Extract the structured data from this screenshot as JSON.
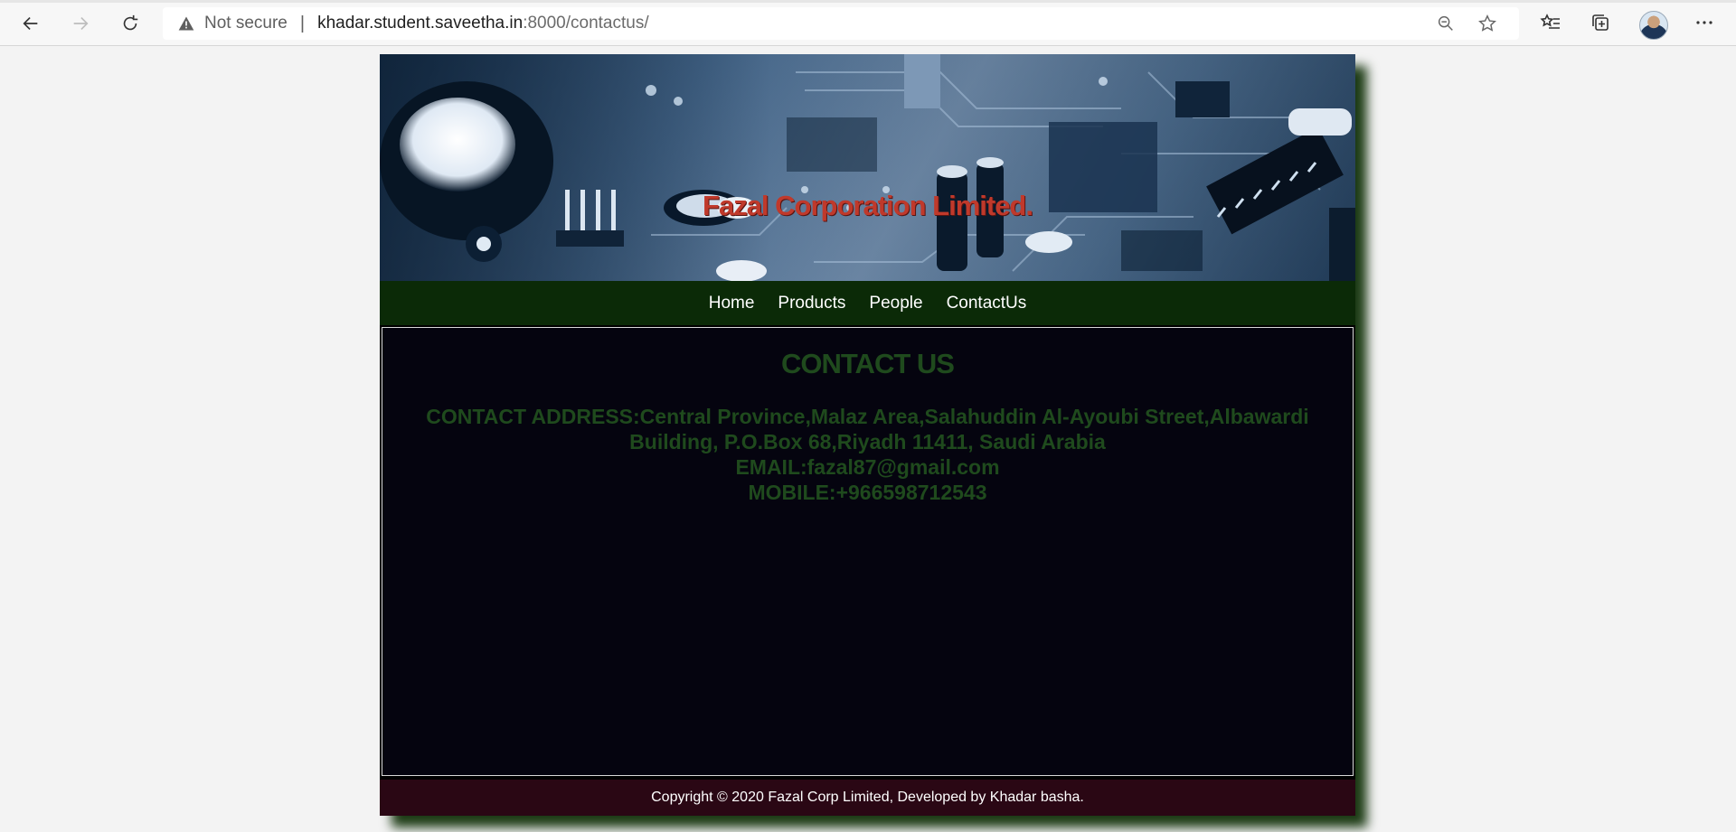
{
  "browser": {
    "security_label": "Not secure",
    "url_host": "khadar.student.saveetha.in",
    "url_rest": ":8000/contactus/"
  },
  "site": {
    "banner_title": "Fazal Corporation Limited.",
    "nav": [
      "Home",
      "Products",
      "People",
      "ContactUs"
    ],
    "section_title": "CONTACT US",
    "address_line": "CONTACT ADDRESS:Central Province,Malaz Area,Salahuddin Al-Ayoubi Street,Albawardi Building, P.O.Box 68,Riyadh 11411, Saudi Arabia",
    "email_line": "EMAIL:fazal87@gmail.com",
    "mobile_line": "MOBILE:+966598712543",
    "footer": "Copyright © 2020 Fazal Corp Limited, Developed by Khadar basha."
  },
  "colors": {
    "banner_title": "#c0392b",
    "nav_background": "#0b2a07",
    "content_background": "#05040f",
    "content_text": "#1f4a1d",
    "footer_background": "#2a0714"
  },
  "icons": [
    "back-icon",
    "forward-icon",
    "refresh-icon",
    "warning-icon",
    "zoom-icon",
    "favorite-star-icon",
    "favorites-list-icon",
    "collections-icon",
    "profile-avatar",
    "more-icon"
  ]
}
